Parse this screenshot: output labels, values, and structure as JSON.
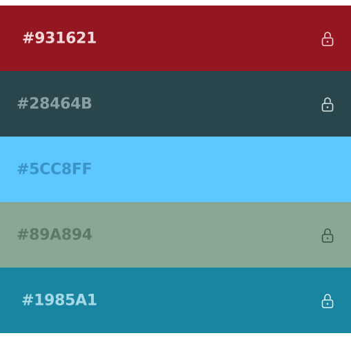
{
  "palette": {
    "swatches": [
      {
        "hex": "#931621",
        "color": "#931621",
        "text_color": "#F2D8DA",
        "lock_color": "#F2D8DA",
        "icon": "unlocked-padlock-icon",
        "show_lock": true
      },
      {
        "hex": "#28464B",
        "color": "#28464B",
        "text_color": "#8A9FA2",
        "lock_color": "#DCE5E6",
        "icon": "unlocked-padlock-icon",
        "show_lock": true
      },
      {
        "hex": "#5CC8FF",
        "color": "#5CC8FF",
        "text_color": "#3C93C8",
        "lock_color": "#3C93C8",
        "icon": "unlocked-padlock-icon",
        "show_lock": false
      },
      {
        "hex": "#89A894",
        "color": "#89A894",
        "text_color": "#5E7868",
        "lock_color": "#3E4F44",
        "icon": "unlocked-padlock-icon",
        "show_lock": true
      },
      {
        "hex": "#1985A1",
        "color": "#1985A1",
        "text_color": "#A6D9E7",
        "lock_color": "#E3F4F8",
        "icon": "unlocked-padlock-icon",
        "show_lock": true
      }
    ]
  }
}
